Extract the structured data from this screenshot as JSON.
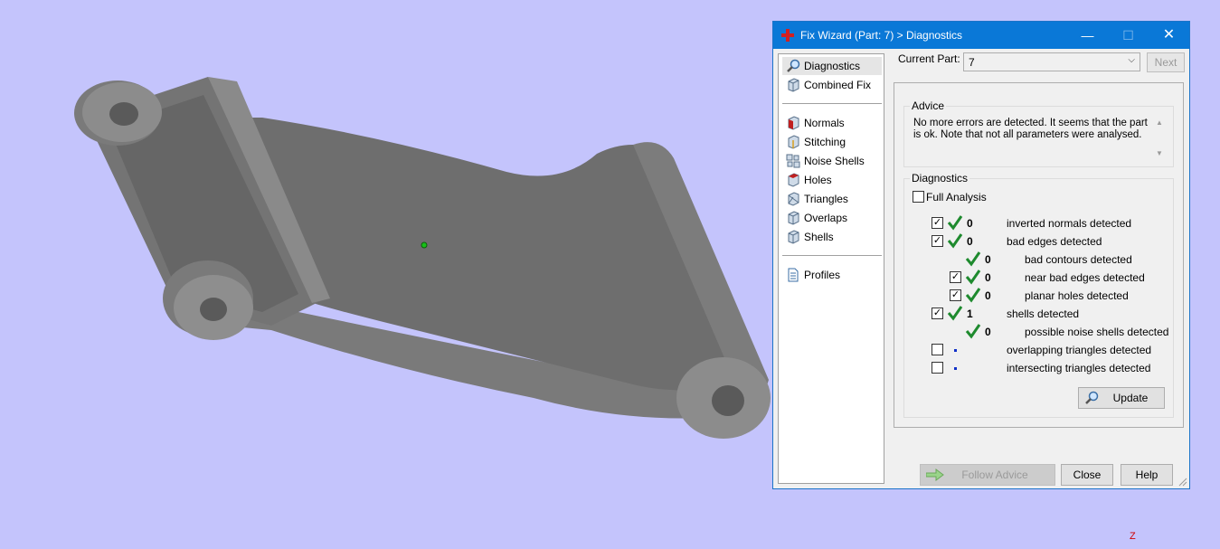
{
  "window": {
    "title": "Fix Wizard (Part: 7) > Diagnostics",
    "min_glyph": "—",
    "max_glyph": "☐",
    "close_glyph": "✕"
  },
  "sidebar": {
    "items": [
      {
        "label": "Diagnostics",
        "icon": "magnifier-icon",
        "active": true
      },
      {
        "label": "Combined Fix",
        "icon": "cube-icon"
      },
      {
        "label": "Normals",
        "icon": "normals-cube-icon"
      },
      {
        "label": "Stitching",
        "icon": "stitching-cube-icon"
      },
      {
        "label": "Noise Shells",
        "icon": "noise-shells-icon"
      },
      {
        "label": "Holes",
        "icon": "holes-cube-icon"
      },
      {
        "label": "Triangles",
        "icon": "triangles-cube-icon"
      },
      {
        "label": "Overlaps",
        "icon": "overlaps-cube-icon"
      },
      {
        "label": "Shells",
        "icon": "shells-cube-icon"
      },
      {
        "label": "Profiles",
        "icon": "document-icon"
      }
    ]
  },
  "current_part": {
    "label": "Current Part:",
    "value": "7",
    "next_label": "Next"
  },
  "advice": {
    "title": "Advice",
    "line1": "No more errors are detected. It seems that the part",
    "line2": "is ok. Note that not all parameters were analysed."
  },
  "diagnostics": {
    "title": "Diagnostics",
    "full_analysis_label": "Full Analysis",
    "full_analysis_checked": false,
    "rows": [
      {
        "checked": true,
        "status": "ok",
        "count": "0",
        "label": "inverted normals detected",
        "indent": 0
      },
      {
        "checked": true,
        "status": "ok",
        "count": "0",
        "label": "bad edges detected",
        "indent": 0
      },
      {
        "checked": null,
        "status": "ok",
        "count": "0",
        "label": "bad contours detected",
        "indent": 1
      },
      {
        "checked": true,
        "status": "ok",
        "count": "0",
        "label": "near bad edges detected",
        "indent": 1
      },
      {
        "checked": true,
        "status": "ok",
        "count": "0",
        "label": "planar holes detected",
        "indent": 1
      },
      {
        "checked": true,
        "status": "ok",
        "count": "1",
        "label": "shells detected",
        "indent": 0
      },
      {
        "checked": null,
        "status": "ok",
        "count": "0",
        "label": "possible noise shells detected",
        "indent": 1
      },
      {
        "checked": false,
        "status": "pending",
        "count": "",
        "label": "overlapping triangles detected",
        "indent": 0
      },
      {
        "checked": false,
        "status": "pending",
        "count": "",
        "label": "intersecting triangles detected",
        "indent": 0
      }
    ],
    "update_label": "Update"
  },
  "footer": {
    "follow_advice_label": "Follow Advice",
    "close_label": "Close",
    "help_label": "Help"
  },
  "viewport": {
    "axis_label": "Z",
    "background": "#c4c4fc",
    "model_color": "#6e6e6e"
  },
  "colors": {
    "titlebar": "#0a78d7",
    "check_green": "#1e8a2e",
    "pending_dot": "#1030c8"
  }
}
